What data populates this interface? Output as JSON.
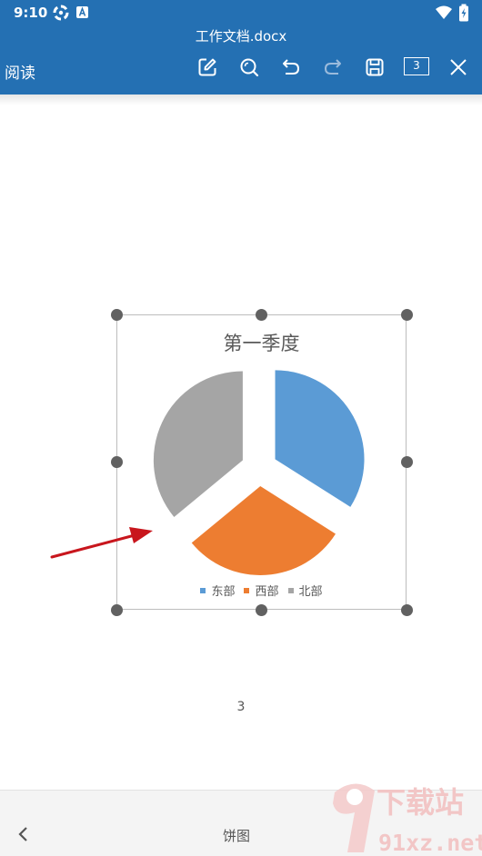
{
  "status_bar": {
    "time": "9:10"
  },
  "header": {
    "file_name": "工作文档.docx",
    "mode": "阅读",
    "page_count": "3"
  },
  "chart_data": {
    "type": "pie",
    "title": "第一季度",
    "categories": [
      "东部",
      "西部",
      "北部"
    ],
    "values": [
      34,
      30,
      36
    ],
    "colors": [
      "#5b9bd5",
      "#ed7d31",
      "#a5a5a5"
    ],
    "exploded": true,
    "legend": "bottom"
  },
  "document": {
    "page_number": "3"
  },
  "bottom_bar": {
    "label": "饼图"
  },
  "watermark": {
    "text_top": "下载站",
    "text_bottom": "91xz.net"
  },
  "icons": {
    "edit": "edit-icon",
    "search": "search-icon",
    "undo": "undo-icon",
    "redo": "redo-icon",
    "save": "save-icon",
    "close": "close-icon",
    "back": "chevron-left-icon"
  }
}
